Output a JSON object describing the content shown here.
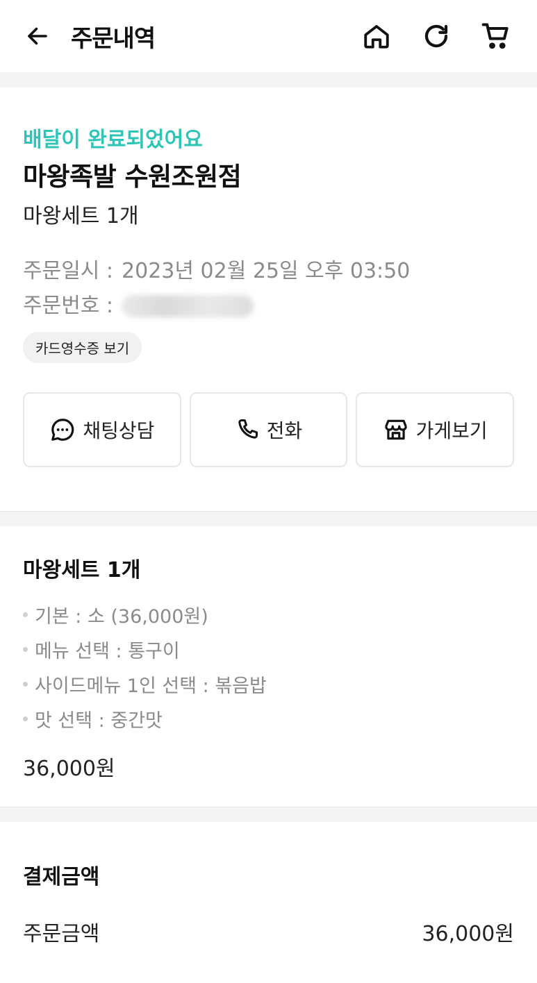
{
  "header": {
    "title": "주문내역",
    "icons": [
      "back-arrow-icon",
      "home-icon",
      "refresh-icon",
      "cart-icon"
    ]
  },
  "order": {
    "status": "배달이 완료되었어요",
    "store_name": "마왕족발 수원조원점",
    "summary": "마왕세트 1개",
    "date_label": "주문일시 :",
    "date_value": "2023년 02월 25일 오후 03:50",
    "number_label": "주문번호 :",
    "receipt_label": "카드영수증 보기"
  },
  "actions": {
    "chat": "채팅상담",
    "call": "전화",
    "store": "가게보기"
  },
  "item": {
    "title": "마왕세트 1개",
    "options": [
      "기본 : 소 (36,000원)",
      "메뉴 선택 : 통구이",
      "사이드메뉴 1인 선택 : 볶음밥",
      "맛 선택 : 중간맛"
    ],
    "price": "36,000원"
  },
  "payment": {
    "title": "결제금액",
    "order_amount_label": "주문금액",
    "order_amount_value": "36,000원"
  },
  "colors": {
    "accent": "#2ec4b6",
    "muted_text": "#8a8a8a",
    "divider": "#f3f3f3"
  }
}
